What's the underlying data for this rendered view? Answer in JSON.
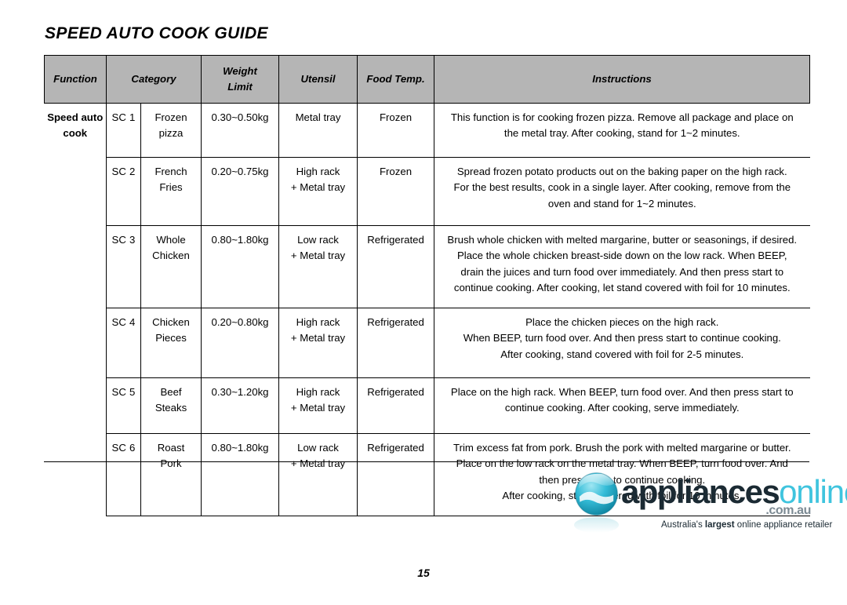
{
  "document": {
    "title": "SPEED AUTO COOK GUIDE",
    "page_number": "15"
  },
  "table": {
    "headers": {
      "function": "Function",
      "category": "Category",
      "weight_limit_line1": "Weight",
      "weight_limit_line2": "Limit",
      "utensil": "Utensil",
      "food_temp": "Food Temp.",
      "instructions": "Instructions"
    },
    "function_label_line1": "Speed auto",
    "function_label_line2": "cook",
    "rows": [
      {
        "code": "SC 1",
        "category_line1": "Frozen",
        "category_line2": "pizza",
        "weight": "0.30~0.50kg",
        "utensil_line1": "Metal tray",
        "utensil_line2": "",
        "food_temp": "Frozen",
        "instructions_line1": "This function is for cooking frozen pizza. Remove all package and place on",
        "instructions_line2": "the metal tray. After cooking, stand for 1~2 minutes.",
        "instructions_line3": "",
        "instructions_line4": ""
      },
      {
        "code": "SC 2",
        "category_line1": "French",
        "category_line2": "Fries",
        "weight": "0.20~0.75kg",
        "utensil_line1": "High rack",
        "utensil_line2": "+ Metal tray",
        "food_temp": "Frozen",
        "instructions_line1": "Spread frozen potato products out on the baking paper on the high rack.",
        "instructions_line2": "For the best results, cook in a single layer. After cooking, remove from the",
        "instructions_line3": "oven and stand for 1~2 minutes.",
        "instructions_line4": ""
      },
      {
        "code": "SC 3",
        "category_line1": "Whole",
        "category_line2": "Chicken",
        "weight": "0.80~1.80kg",
        "utensil_line1": "Low rack",
        "utensil_line2": "+ Metal tray",
        "food_temp": "Refrigerated",
        "instructions_line1": "Brush whole chicken with melted margarine, butter or seasonings, if desired.",
        "instructions_line2": "Place the whole chicken breast-side down on the low rack. When BEEP,",
        "instructions_line3": "drain the juices and turn food over immediately. And then press start to",
        "instructions_line4": "continue cooking. After cooking, let stand covered with foil for 10 minutes."
      },
      {
        "code": "SC 4",
        "category_line1": "Chicken",
        "category_line2": "Pieces",
        "weight": "0.20~0.80kg",
        "utensil_line1": "High rack",
        "utensil_line2": "+ Metal tray",
        "food_temp": "Refrigerated",
        "instructions_line1": "Place the chicken pieces on the high rack.",
        "instructions_line2": "When BEEP, turn food over. And then press start to continue cooking.",
        "instructions_line3": "After cooking, stand covered with foil for 2-5 minutes.",
        "instructions_line4": ""
      },
      {
        "code": "SC 5",
        "category_line1": "Beef",
        "category_line2": "Steaks",
        "weight": "0.30~1.20kg",
        "utensil_line1": "High rack",
        "utensil_line2": "+ Metal tray",
        "food_temp": "Refrigerated",
        "instructions_line1": "Place on the high rack. When BEEP, turn food over. And then press start to",
        "instructions_line2": "continue cooking. After cooking, serve immediately.",
        "instructions_line3": "",
        "instructions_line4": ""
      },
      {
        "code": "SC 6",
        "category_line1": "Roast",
        "category_line2": "Pork",
        "weight": "0.80~1.80kg",
        "utensil_line1": "Low rack",
        "utensil_line2": "+ Metal tray",
        "food_temp": "Refrigerated",
        "instructions_line1": "Trim excess fat from pork. Brush the pork with melted margarine or butter.",
        "instructions_line2": "Place on the low rack on the metal tray. When BEEP, turn food over. And",
        "instructions_line3": "then press start to continue cooking.",
        "instructions_line4": "After cooking, stand covered with foil for 10 minutes."
      }
    ]
  },
  "logo": {
    "word_primary": "appliances",
    "word_secondary": "online",
    "tld": ".com.au",
    "tagline_prefix": "Australia's ",
    "tagline_emphasis": "largest",
    "tagline_suffix": " online appliance retailer",
    "sphere_color": "#2fb8d4",
    "primary_color": "#1b2a33",
    "secondary_color": "#3fc4de"
  }
}
